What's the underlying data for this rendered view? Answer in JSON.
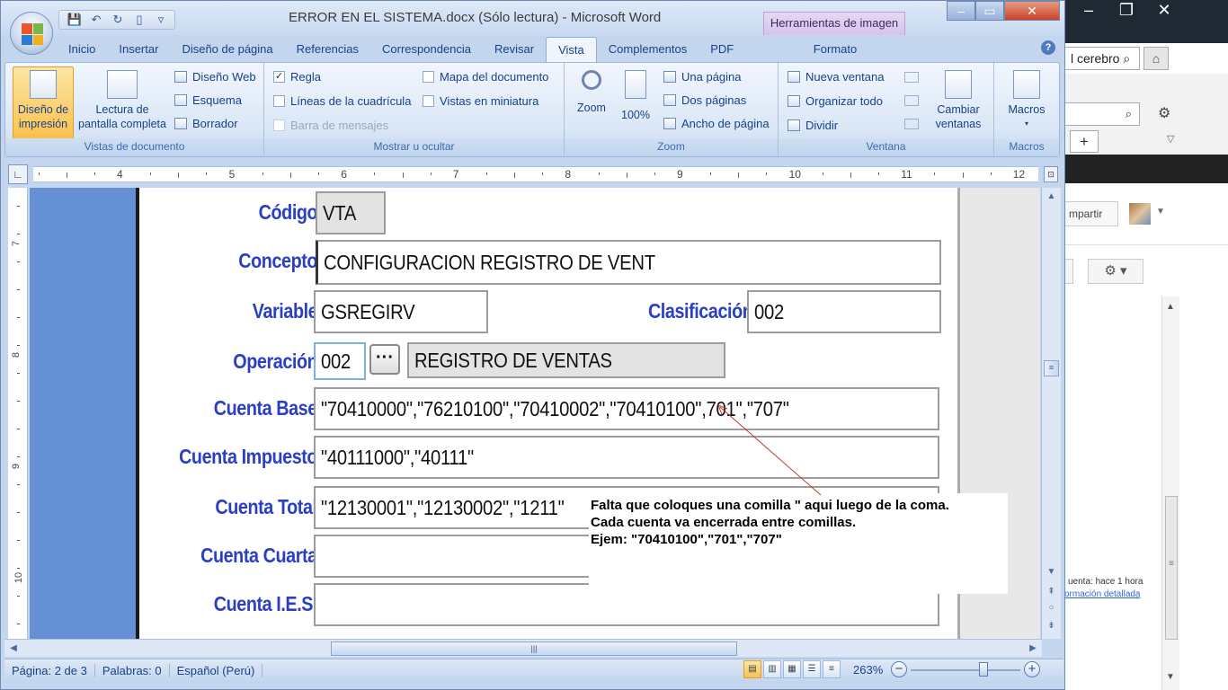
{
  "browser_bg": {
    "address_text": "l cerebro",
    "share_text": "mpartir",
    "status_line1": "uenta: hace 1 hora",
    "status_line2": "ormación detallada"
  },
  "window": {
    "title": "ERROR EN EL SISTEMA.docx (Sólo lectura) - Microsoft Word",
    "contextual_tab_group": "Herramientas de imagen"
  },
  "tabs": [
    "Inicio",
    "Insertar",
    "Diseño de página",
    "Referencias",
    "Correspondencia",
    "Revisar",
    "Vista",
    "Complementos",
    "PDF"
  ],
  "active_tab": "Vista",
  "contextual_tab": "Formato",
  "ribbon": {
    "vistas": {
      "label": "Vistas de documento",
      "print_layout": "Diseño de\nimpresión",
      "full_screen_reading": "Lectura de\npantalla completa",
      "web_layout": "Diseño Web",
      "outline": "Esquema",
      "draft": "Borrador"
    },
    "mostrar": {
      "label": "Mostrar u ocultar",
      "ruler": "Regla",
      "ruler_checked": true,
      "gridlines": "Líneas de la cuadrícula",
      "message_bar": "Barra de mensajes",
      "doc_map": "Mapa del documento",
      "thumbnails": "Vistas en miniatura"
    },
    "zoom": {
      "label": "Zoom",
      "zoom": "Zoom",
      "hundred": "100%",
      "one_page": "Una página",
      "two_pages": "Dos páginas",
      "page_width": "Ancho de página"
    },
    "ventana": {
      "label": "Ventana",
      "new_window": "Nueva ventana",
      "arrange_all": "Organizar todo",
      "split": "Dividir",
      "switch_windows": "Cambiar\nventanas"
    },
    "macros": {
      "label": "Macros",
      "macros": "Macros"
    }
  },
  "ruler_numbers": [
    "4",
    "5",
    "6",
    "7",
    "8",
    "9",
    "10",
    "11",
    "12"
  ],
  "vruler_numbers": [
    "7",
    "8",
    "9",
    "10"
  ],
  "form": {
    "codigo": {
      "label": "Código",
      "value": "VTA"
    },
    "concepto": {
      "label": "Concepto",
      "value": "CONFIGURACION REGISTRO DE VENT"
    },
    "variable": {
      "label": "Variable",
      "value": "GSREGIRV"
    },
    "clasificacion": {
      "label": "Clasificación",
      "value": "002"
    },
    "operacion": {
      "label": "Operación",
      "value": "002",
      "button": "···",
      "description": "REGISTRO DE VENTAS"
    },
    "cuenta_base": {
      "label": "Cuenta Base",
      "value": "\"70410000\",\"76210100\",\"70410002\",\"70410100\",701\",\"707\""
    },
    "cuenta_impuesto": {
      "label": "Cuenta Impuesto",
      "value": "\"40111000\",\"40111\""
    },
    "cuenta_total": {
      "label": "Cuenta Total",
      "value": "\"12130001\",\"12130002\",\"1211\""
    },
    "cuenta_cuarta": {
      "label": "Cuenta Cuarta",
      "value": ""
    },
    "cuenta_ies": {
      "label": "Cuenta I.E.S.",
      "value": ""
    }
  },
  "callout": {
    "line1": "Falta que coloques una comilla \" aqui luego de la coma.",
    "line2": "Cada cuenta va encerrada entre comillas.",
    "line3": "Ejem: \"70410100\",\"701\",\"707\""
  },
  "status_bar": {
    "page": "Página: 2 de 3",
    "words": "Palabras: 0",
    "language": "Español (Perú)",
    "zoom_level": "263%"
  },
  "colors": {
    "label_blue": "#2a3fc4",
    "ribbon_blue": "#c4d6ee",
    "selected_orange": "#fbc04c"
  }
}
